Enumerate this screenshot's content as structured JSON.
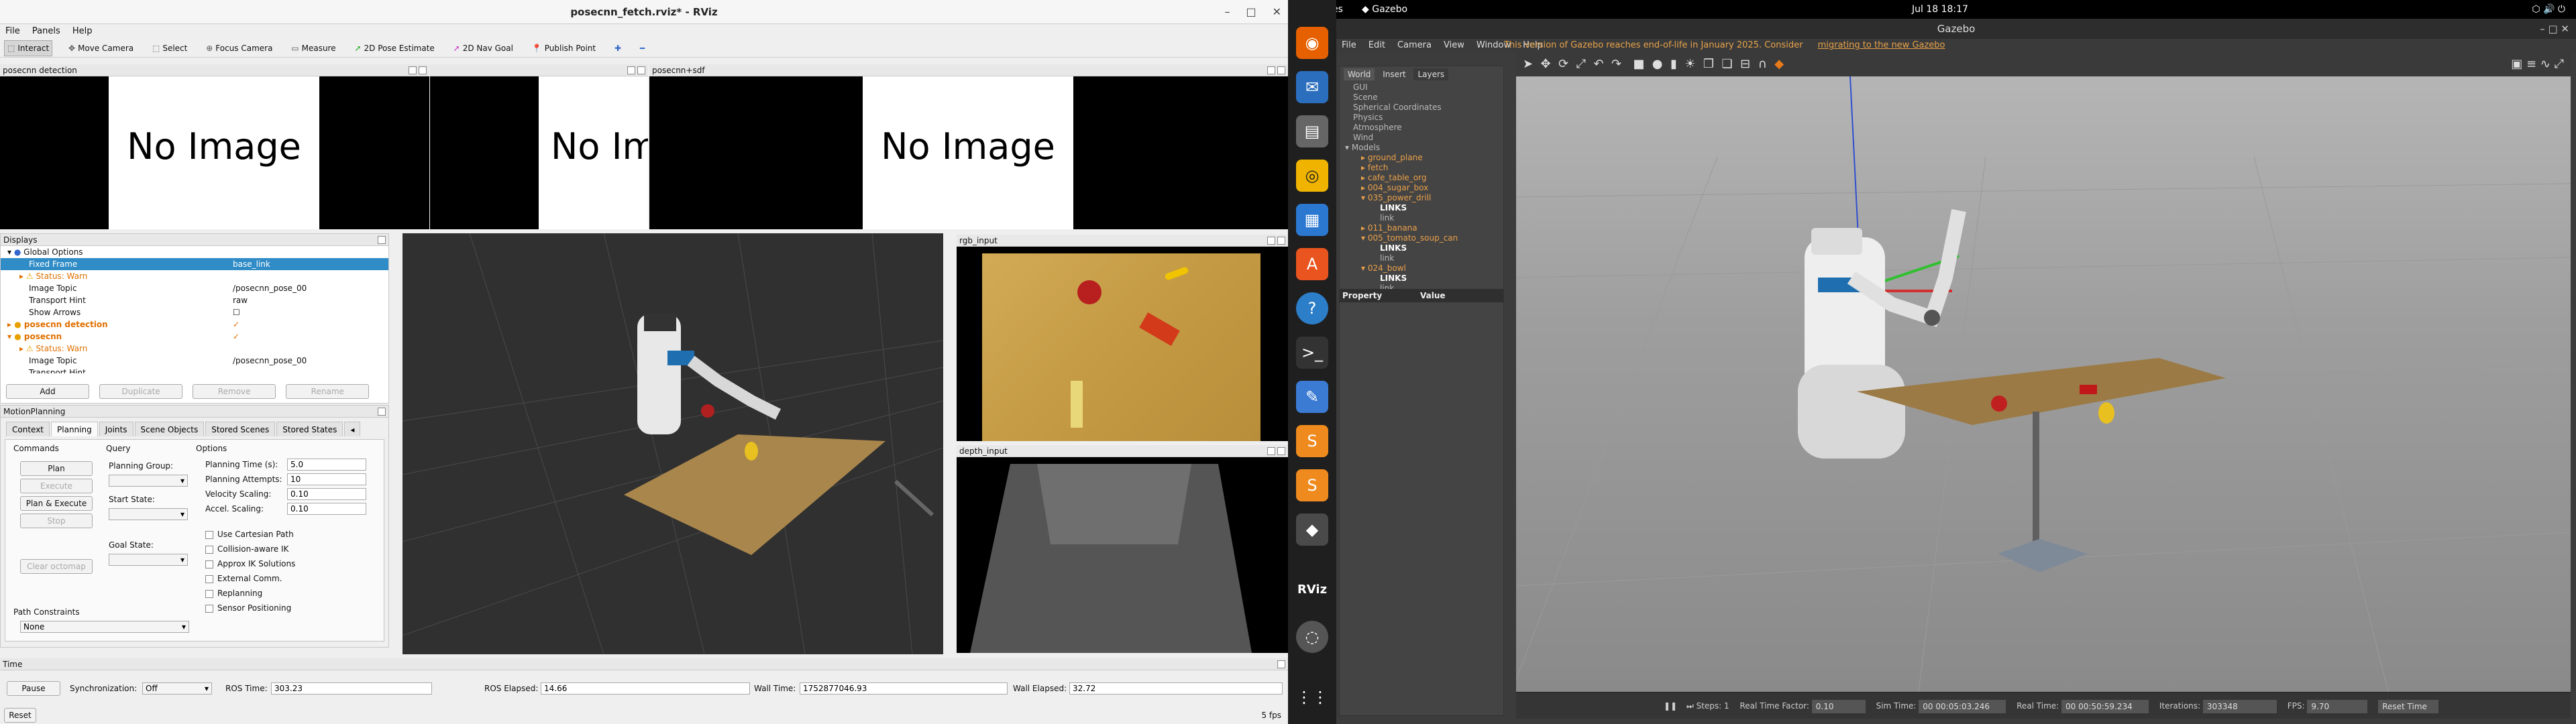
{
  "rviz": {
    "title": "posecnn_fetch.rviz* - RViz",
    "menu": [
      "File",
      "Panels",
      "Help"
    ],
    "toolbar": [
      "Interact",
      "Move Camera",
      "Select",
      "Focus Camera",
      "Measure",
      "2D Pose Estimate",
      "2D Nav Goal",
      "Publish Point"
    ],
    "panel_posecnn_detection": "posecnn detection",
    "panel_posecnn_sdf": "posecnn+sdf",
    "no_image": "No Image",
    "displays": {
      "title": "Displays",
      "rows": [
        {
          "label": "Global Options",
          "value": ""
        },
        {
          "label": "Fixed Frame",
          "value": "base_link"
        },
        {
          "label": "Status: Warn",
          "value": ""
        },
        {
          "label": "Image Topic",
          "value": "/posecnn_pose_00"
        },
        {
          "label": "Transport Hint",
          "value": "raw"
        },
        {
          "label": "Show Arrows",
          "value": ""
        },
        {
          "label": "posecnn detection",
          "value": "✓"
        },
        {
          "label": "posecnn",
          "value": "✓"
        },
        {
          "label": "Status: Warn",
          "value": ""
        },
        {
          "label": "Image Topic",
          "value": "/posecnn_pose_00"
        },
        {
          "label": "Transport Hint",
          "value": ""
        }
      ],
      "buttons": [
        "Add",
        "Duplicate",
        "Remove",
        "Rename"
      ]
    },
    "motion_planning": {
      "title": "MotionPlanning",
      "tabs": [
        "Context",
        "Planning",
        "Joints",
        "Scene Objects",
        "Stored Scenes",
        "Stored States"
      ],
      "commands_label": "Commands",
      "query_label": "Query",
      "options_label": "Options",
      "cmd_buttons": [
        "Plan",
        "Execute",
        "Plan & Execute",
        "Stop",
        "Clear octomap"
      ],
      "planning_group": "Planning Group:",
      "start_state": "Start State:",
      "goal_state": "Goal State:",
      "opts": [
        {
          "label": "Planning Time (s):",
          "value": "5.0"
        },
        {
          "label": "Planning Attempts:",
          "value": "10"
        },
        {
          "label": "Velocity Scaling:",
          "value": "0.10"
        },
        {
          "label": "Accel. Scaling:",
          "value": "0.10"
        }
      ],
      "checks": [
        "Use Cartesian Path",
        "Collision-aware IK",
        "Approx IK Solutions",
        "External Comm.",
        "Replanning",
        "Sensor Positioning"
      ],
      "path_constraints": "Path Constraints",
      "path_constraints_value": "None"
    },
    "rgb_input": "rgb_input",
    "depth_input": "depth_input",
    "time": {
      "title": "Time",
      "pause": "Pause",
      "sync_label": "Synchronization:",
      "sync_value": "Off",
      "ros_time_label": "ROS Time:",
      "ros_time": "303.23",
      "ros_elapsed_label": "ROS Elapsed:",
      "ros_elapsed": "14.66",
      "wall_time_label": "Wall Time:",
      "wall_time": "1752877046.93",
      "wall_elapsed_label": "Wall Elapsed:",
      "wall_elapsed": "32.72",
      "reset": "Reset",
      "fps": "5 fps"
    }
  },
  "topbar": {
    "activities": "Activities",
    "app": "Gazebo",
    "clock": "Jul 18  18:17"
  },
  "gazebo": {
    "title": "Gazebo",
    "menu": [
      "File",
      "Edit",
      "Camera",
      "View",
      "Window",
      "Help"
    ],
    "banner": "This version of Gazebo reaches end-of-life in January 2025. Consider",
    "banner_link": "migrating to the new Gazebo",
    "tabs": [
      "World",
      "Insert",
      "Layers"
    ],
    "tree": [
      "GUI",
      "Scene",
      "Spherical Coordinates",
      "Physics",
      "Atmosphere",
      "Wind",
      "Models",
      "ground_plane",
      "fetch",
      "cafe_table_org",
      "004_sugar_box",
      "035_power_drill",
      "LINKS",
      "link",
      "011_banana",
      "005_tomato_soup_can",
      "LINKS",
      "link",
      "024_bowl",
      "LINKS",
      "link"
    ],
    "property_header": "Property",
    "value_header": "Value",
    "bottom": {
      "steps_label": "Steps:",
      "steps": "1",
      "rtf_label": "Real Time Factor:",
      "rtf": "0.10",
      "sim_time_label": "Sim Time:",
      "sim_time": "00 00:05:03.246",
      "real_time_label": "Real Time:",
      "real_time": "00 00:50:59.234",
      "iter_label": "Iterations:",
      "iter": "303348",
      "fps_label": "FPS:",
      "fps": "9.70",
      "reset": "Reset Time"
    }
  }
}
